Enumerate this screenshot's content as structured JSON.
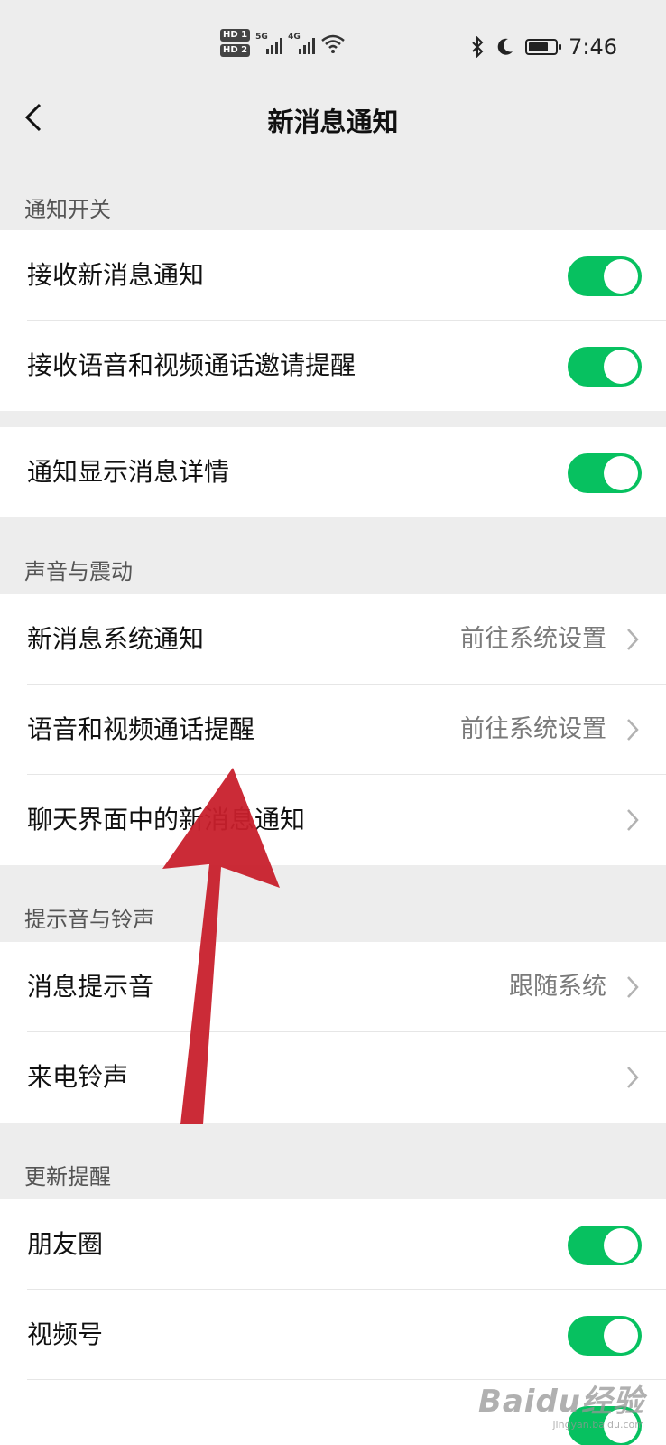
{
  "status_bar": {
    "sim1_badge": "HD 1",
    "sim2_badge": "HD 2",
    "network1": "5G",
    "network2": "4G",
    "time": "7:46",
    "battery_level": 0.74,
    "icons": [
      "signal-icon",
      "wifi-icon",
      "bluetooth-icon",
      "moon-icon",
      "battery-icon"
    ]
  },
  "nav": {
    "title": "新消息通知",
    "back_icon": "chevron-left-icon"
  },
  "sections": {
    "notify_switch": {
      "header": "通知开关",
      "receive_new": {
        "label": "接收新消息通知",
        "on": true
      },
      "receive_call": {
        "label": "接收语音和视频通话邀请提醒",
        "on": true
      },
      "show_details": {
        "label": "通知显示消息详情",
        "on": true
      }
    },
    "sound_vibration": {
      "header": "声音与震动",
      "system_notify": {
        "label": "新消息系统通知",
        "value": "前往系统设置"
      },
      "call_remind": {
        "label": "语音和视频通话提醒",
        "value": "前往系统设置"
      },
      "chat_notify": {
        "label": "聊天界面中的新消息通知"
      }
    },
    "tones": {
      "header": "提示音与铃声",
      "message_tone": {
        "label": "消息提示音",
        "value": "跟随系统"
      },
      "ringtone": {
        "label": "来电铃声"
      }
    },
    "updates": {
      "header": "更新提醒",
      "moments": {
        "label": "朋友圈",
        "on": true
      },
      "channels": {
        "label": "视频号",
        "on": true
      },
      "live": {
        "on": true
      }
    }
  },
  "watermark": {
    "main": "Baidu经验",
    "sub": "jingyan.baidu.com"
  },
  "colors": {
    "toggle_on": "#07c160",
    "background": "#ededed",
    "annotation_arrow": "#c8202c"
  }
}
